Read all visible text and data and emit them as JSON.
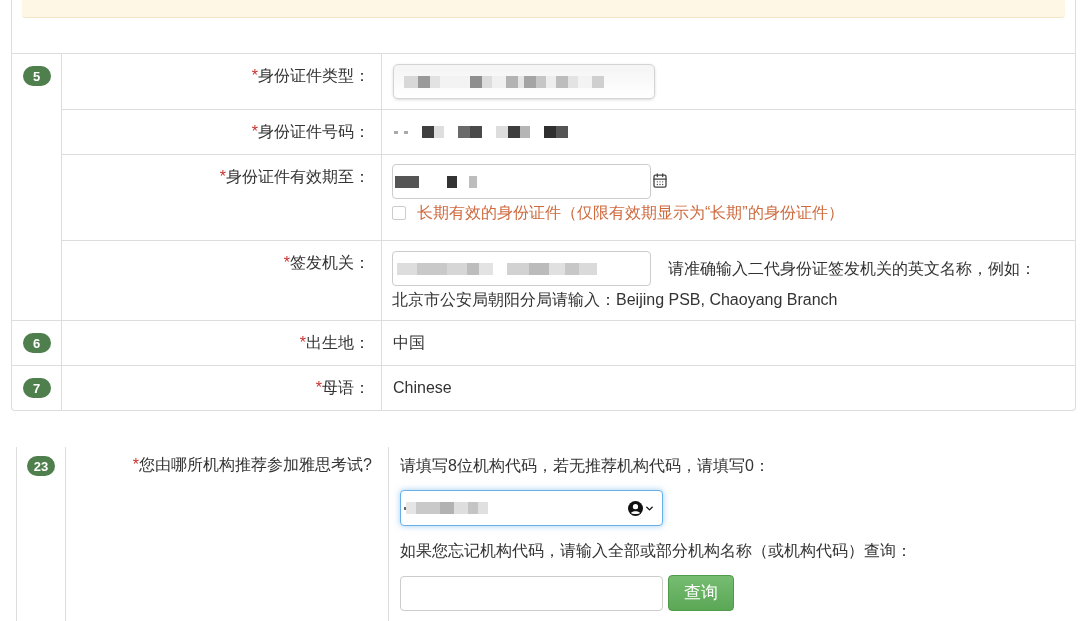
{
  "sections": [
    {
      "number": "5",
      "fields": [
        {
          "kind": "select",
          "required_mark": "*",
          "label": "身份证件类型："
        },
        {
          "kind": "plain",
          "required_mark": "*",
          "label": "身份证件号码："
        },
        {
          "kind": "date",
          "required_mark": "*",
          "label": "身份证件有效期至：",
          "option": {
            "label": "长期有效的身份证件（仅限有效期显示为“长期”的身份证件）",
            "checked": false
          }
        },
        {
          "kind": "input_hint",
          "required_mark": "*",
          "label": "签发机关：",
          "hint": "请准确输入二代身份证签发机关的英文名称，例如：",
          "example": "北京市公安局朝阳分局请输入：Beijing PSB, Chaoyang Branch"
        }
      ]
    },
    {
      "number": "6",
      "fields": [
        {
          "kind": "value",
          "required_mark": "*",
          "label": "出生地：",
          "value": "中国"
        }
      ]
    },
    {
      "number": "7",
      "fields": [
        {
          "kind": "value",
          "required_mark": "*",
          "label": "母语：",
          "value": "Chinese"
        }
      ]
    }
  ],
  "referral": {
    "number": "23",
    "required_mark": "*",
    "label": "您由哪所机构推荐参加雅思考试?",
    "code_hint": "请填写8位机构代码，若无推荐机构代码，请填写0：",
    "code_field": {
      "focused": true
    },
    "search_hint": "如果您忘记机构代码，请输入全部或部分机构名称（或机构代码）查询：",
    "search_button": "查询"
  }
}
